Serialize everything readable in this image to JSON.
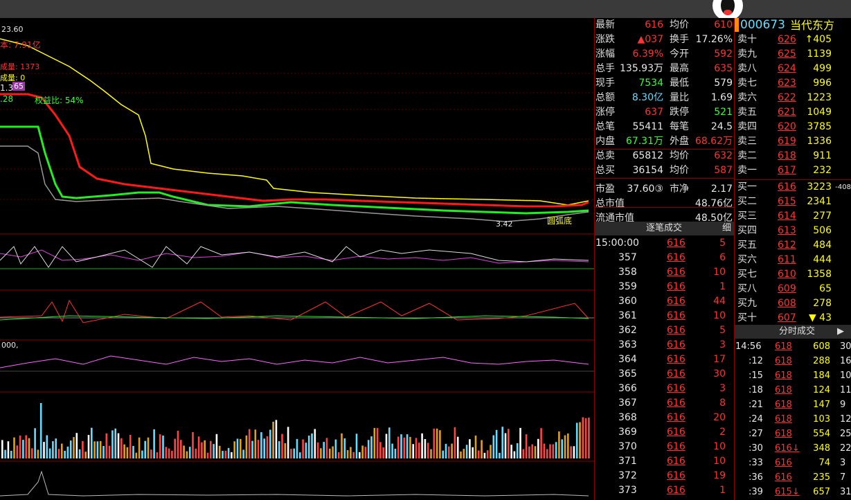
{
  "chart": {
    "main_labels": {
      "price_top": "23.60",
      "cost": "本: 7.91亿",
      "vol1": "成量: 1373",
      "vol2": "成量: 0",
      "ratio_val": "1.386",
      "badge": "65",
      "left_val": ".28",
      "equity": "权益比: 54%",
      "low_price": "3.42",
      "bottom_tag": "圆弧底"
    },
    "panel3_label": "000,",
    "colors": {
      "yellow": "#ffff00",
      "red": "#ff2020",
      "green": "#22ee22",
      "gray": "#999999",
      "magenta": "#ff44ff"
    }
  },
  "stock": {
    "code": "000673",
    "name": "当代东方"
  },
  "quote": {
    "rows": [
      {
        "l1": "最新",
        "v1": "616",
        "l2": "均价",
        "v2": "610"
      },
      {
        "l1": "涨跌",
        "v1": "▲037",
        "l2": "换手",
        "v2": "17.26%"
      },
      {
        "l1": "涨幅",
        "v1": "6.39%",
        "l2": "今开",
        "v2": "592"
      },
      {
        "l1": "总手",
        "v1": "135.93万",
        "l2": "最高",
        "v2": "635"
      },
      {
        "l1": "现手",
        "v1": "7534",
        "l2": "最低",
        "v2": "579"
      },
      {
        "l1": "总额",
        "v1": "8.30亿",
        "l2": "量比",
        "v2": "1.69"
      },
      {
        "l1": "涨停",
        "v1": "637",
        "l2": "跌停",
        "v2": "521"
      },
      {
        "l1": "总笔",
        "v1": "55411",
        "l2": "每笔",
        "v2": "24.5"
      },
      {
        "l1": "内盘",
        "v1": "67.31万",
        "l2": "外盘",
        "v2": "68.62万"
      },
      {
        "l1": "总卖",
        "v1": "65812",
        "l2": "均价",
        "v2": "632"
      },
      {
        "l1": "总买",
        "v1": "36154",
        "l2": "均价",
        "v2": "587"
      },
      {
        "l1": "市盈",
        "v1": "37.60③",
        "l2": "市净",
        "v2": "2.17"
      },
      {
        "l1": "总市值",
        "v1": "",
        "l2": "",
        "v2": "48.76亿"
      },
      {
        "l1": "流通市值",
        "v1": "",
        "l2": "",
        "v2": "48.50亿"
      }
    ]
  },
  "ticks": {
    "title": "逐笔成交",
    "detail": "细",
    "rows": [
      {
        "t": "15:00:00",
        "p": "616",
        "v": "5"
      },
      {
        "t": "357",
        "p": "616",
        "v": "6"
      },
      {
        "t": "358",
        "p": "616",
        "v": "10"
      },
      {
        "t": "359",
        "p": "616",
        "v": "1"
      },
      {
        "t": "360",
        "p": "616",
        "v": "44"
      },
      {
        "t": "361",
        "p": "616",
        "v": "10"
      },
      {
        "t": "362",
        "p": "616",
        "v": "5"
      },
      {
        "t": "363",
        "p": "616",
        "v": "3"
      },
      {
        "t": "364",
        "p": "616",
        "v": "17"
      },
      {
        "t": "365",
        "p": "616",
        "v": "30"
      },
      {
        "t": "366",
        "p": "616",
        "v": "3"
      },
      {
        "t": "367",
        "p": "616",
        "v": "8"
      },
      {
        "t": "368",
        "p": "616",
        "v": "20"
      },
      {
        "t": "369",
        "p": "616",
        "v": "2"
      },
      {
        "t": "370",
        "p": "616",
        "v": "10"
      },
      {
        "t": "371",
        "p": "616",
        "v": "10"
      },
      {
        "t": "372",
        "p": "616",
        "v": "19"
      },
      {
        "t": "373",
        "p": "616",
        "v": "1"
      }
    ]
  },
  "book": {
    "sells": [
      {
        "l": "卖十",
        "p": "626",
        "v": "↑405"
      },
      {
        "l": "卖九",
        "p": "625",
        "v": "1139"
      },
      {
        "l": "卖八",
        "p": "624",
        "v": "499"
      },
      {
        "l": "卖七",
        "p": "623",
        "v": "996"
      },
      {
        "l": "卖六",
        "p": "622",
        "v": "1223"
      },
      {
        "l": "卖五",
        "p": "621",
        "v": "1049"
      },
      {
        "l": "卖四",
        "p": "620",
        "v": "3785"
      },
      {
        "l": "卖三",
        "p": "619",
        "v": "1336"
      },
      {
        "l": "卖二",
        "p": "618",
        "v": "911"
      },
      {
        "l": "卖一",
        "p": "617",
        "v": "232"
      }
    ],
    "buys": [
      {
        "l": "买一",
        "p": "616",
        "v": "3223",
        "x": "-408"
      },
      {
        "l": "买二",
        "p": "615",
        "v": "2341",
        "x": ""
      },
      {
        "l": "买三",
        "p": "614",
        "v": "277",
        "x": ""
      },
      {
        "l": "买四",
        "p": "613",
        "v": "506",
        "x": ""
      },
      {
        "l": "买五",
        "p": "612",
        "v": "484",
        "x": ""
      },
      {
        "l": "买六",
        "p": "611",
        "v": "444",
        "x": ""
      },
      {
        "l": "买七",
        "p": "610",
        "v": "1358",
        "x": ""
      },
      {
        "l": "买八",
        "p": "609",
        "v": "65",
        "x": ""
      },
      {
        "l": "买九",
        "p": "608",
        "v": "278",
        "x": ""
      },
      {
        "l": "买十",
        "p": "607",
        "v": "▼ 43",
        "x": ""
      }
    ]
  },
  "fenshi": {
    "title": "分时成交",
    "rows": [
      {
        "t": "14:56",
        "p": "618",
        "v": "608",
        "n": "30"
      },
      {
        "t": ":12",
        "p": "618",
        "v": "288",
        "n": "16"
      },
      {
        "t": ":15",
        "p": "618",
        "v": "184",
        "n": "10"
      },
      {
        "t": ":18",
        "p": "618",
        "v": "124",
        "n": "11"
      },
      {
        "t": ":21",
        "p": "618",
        "v": "147",
        "n": "9"
      },
      {
        "t": ":24",
        "p": "618",
        "v": "103",
        "n": "12"
      },
      {
        "t": ":27",
        "p": "618",
        "v": "554",
        "n": "25"
      },
      {
        "t": ":30",
        "p": "616↓",
        "v": "348",
        "n": "22"
      },
      {
        "t": ":33",
        "p": "616",
        "v": "74",
        "n": "3"
      },
      {
        "t": ":36",
        "p": "616",
        "v": "235",
        "n": "7"
      },
      {
        "t": ":39",
        "p": "615↓",
        "v": "657",
        "n": "31"
      }
    ]
  }
}
